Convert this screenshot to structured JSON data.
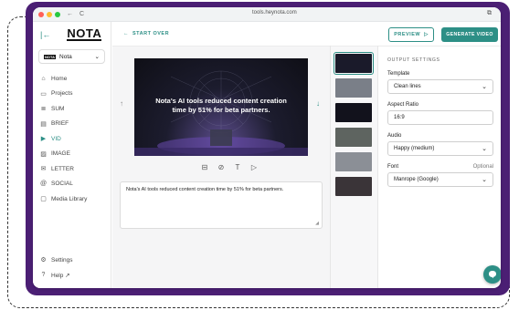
{
  "browser": {
    "url": "tools.heynota.com",
    "nav_back": "←",
    "nav_reload": "C",
    "action_icon": "⧉"
  },
  "sidebar": {
    "logo": "NOTA",
    "collapse_icon": "|←",
    "workspace": {
      "name": "Nota",
      "badge": "NOTA",
      "chevron": "⌄"
    },
    "items": [
      {
        "label": "Home",
        "icon": "home-icon",
        "glyph": "⌂"
      },
      {
        "label": "Projects",
        "icon": "folder-icon",
        "glyph": "▭"
      },
      {
        "label": "SUM",
        "icon": "sum-icon",
        "glyph": "≣"
      },
      {
        "label": "BRIEF",
        "icon": "brief-icon",
        "glyph": "▤"
      },
      {
        "label": "VID",
        "icon": "video-icon",
        "glyph": "▶",
        "active": true
      },
      {
        "label": "IMAGE",
        "icon": "image-icon",
        "glyph": "▨"
      },
      {
        "label": "LETTER",
        "icon": "letter-icon",
        "glyph": "✉"
      },
      {
        "label": "SOCIAL",
        "icon": "social-icon",
        "glyph": "@"
      },
      {
        "label": "Media Library",
        "icon": "media-library-icon",
        "glyph": "▢"
      }
    ],
    "bottom_items": [
      {
        "label": "Settings",
        "icon": "gear-icon",
        "glyph": "⚙"
      },
      {
        "label": "Help ↗",
        "icon": "help-icon",
        "glyph": "?"
      }
    ]
  },
  "topbar": {
    "start_over": "START OVER",
    "start_over_icon": "←",
    "preview_label": "PREVIEW",
    "preview_icon": "▷",
    "generate_label": "GENERATE VIDEO"
  },
  "editor": {
    "slide_text": "Nota's AI tools reduced content creation time by 51% for beta partners.",
    "arrow_up": "↑",
    "arrow_down": "↓",
    "tools": [
      {
        "name": "layout-tool-icon",
        "glyph": "⊟"
      },
      {
        "name": "media-tool-icon",
        "glyph": "⊘"
      },
      {
        "name": "text-tool-icon",
        "glyph": "T"
      },
      {
        "name": "play-tool-icon",
        "glyph": "▷"
      }
    ],
    "caption": "Nota's AI tools reduced content creation time by 51% for beta partners.",
    "resize_glyph": "◢"
  },
  "thumbnails": [
    {
      "color": "#1a1a2a",
      "selected": true
    },
    {
      "color": "#7a7f88",
      "selected": false
    },
    {
      "color": "#12121c",
      "selected": false
    },
    {
      "color": "#5e6460",
      "selected": false
    },
    {
      "color": "#8b8f96",
      "selected": false
    },
    {
      "color": "#3a3438",
      "selected": false
    }
  ],
  "settings": {
    "title": "OUTPUT SETTINGS",
    "template_label": "Template",
    "template_value": "Clean lines",
    "aspect_label": "Aspect Ratio",
    "aspect_value": "16:9",
    "audio_label": "Audio",
    "audio_value": "Happy (medium)",
    "font_label": "Font",
    "font_optional": "Optional",
    "font_value": "Manrope (Google)",
    "chevron": "⌄"
  },
  "colors": {
    "accent": "#2d8f86",
    "frame": "#4b1f74"
  }
}
